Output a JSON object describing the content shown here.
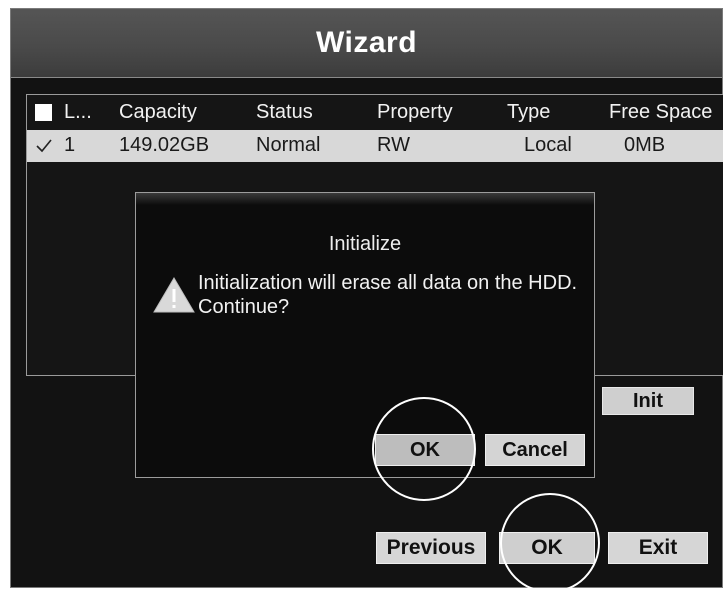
{
  "window": {
    "title": "Wizard"
  },
  "table": {
    "columns": [
      "L...",
      "Capacity",
      "Status",
      "Property",
      "Type",
      "Free Space"
    ],
    "rows": [
      {
        "id": "1",
        "capacity": "149.02GB",
        "status": "Normal",
        "property": "RW",
        "type": "Local",
        "free_space": "0MB",
        "checked": true
      }
    ]
  },
  "buttons": {
    "init": "Init",
    "previous": "Previous",
    "ok": "OK",
    "exit": "Exit"
  },
  "dialog": {
    "title": "Initialize",
    "message_line1": "Initialization will erase all data on the HDD.",
    "message_line2": "Continue?",
    "ok": "OK",
    "cancel": "Cancel",
    "icon": "warning-icon"
  },
  "colors": {
    "background": "#121212",
    "title_bar": "#4a4a4a",
    "selected_row": "#d8d8d8",
    "button": "#d6d6d6"
  }
}
